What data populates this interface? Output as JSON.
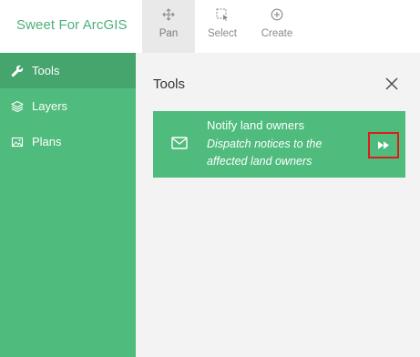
{
  "app": {
    "title": "Sweet For ArcGIS"
  },
  "toolbar": {
    "pan_label": "Pan",
    "select_label": "Select",
    "create_label": "Create",
    "active": "Pan"
  },
  "sidebar": {
    "items": [
      {
        "label": "Tools",
        "icon": "wrench-icon",
        "active": true
      },
      {
        "label": "Layers",
        "icon": "layers-icon",
        "active": false
      },
      {
        "label": "Plans",
        "icon": "image-icon",
        "active": false
      }
    ]
  },
  "panel": {
    "title": "Tools",
    "card": {
      "title": "Notify land owners",
      "description": "Dispatch notices to the affected land owners",
      "icon": "mail-icon",
      "action_icon": "fast-forward-icon"
    }
  },
  "colors": {
    "brand_green": "#4fbb7c",
    "sidebar_active": "#46a56d",
    "highlight_red": "#e01b1b",
    "panel_bg": "#f3f3f3"
  }
}
